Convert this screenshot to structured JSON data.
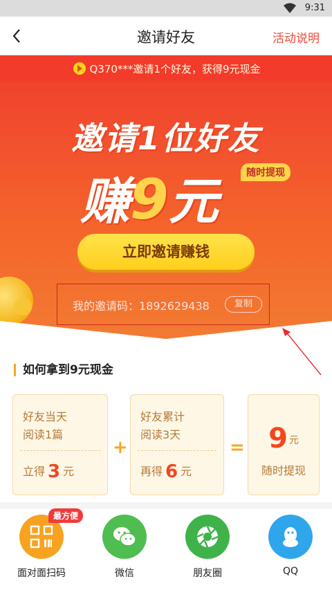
{
  "status_bar": {
    "time": "9:31"
  },
  "nav": {
    "title": "邀请好友",
    "rules_link": "活动说明"
  },
  "ticker": {
    "text": "Q370***邀请1个好友，获得9元现金"
  },
  "hero": {
    "headline": "邀请1位好友",
    "earn_prefix": "赚",
    "earn_amount": "9",
    "earn_unit": "元",
    "badge": "随时提现",
    "cta_label": "立即邀请赚钱",
    "invite_code_label": "我的邀请码：1892629438",
    "copy_label": "复制"
  },
  "howto": {
    "title": "如何拿到9元现金",
    "cards": [
      {
        "line1": "好友当天",
        "line2": "阅读1篇",
        "reward_prefix": "立得",
        "amount": "3",
        "unit": "元"
      },
      {
        "line1": "好友累计",
        "line2": "阅读3天",
        "reward_prefix": "再得",
        "amount": "6",
        "unit": "元"
      }
    ],
    "total": {
      "amount": "9",
      "unit": "元",
      "subtitle": "随时提现"
    },
    "plus": "+",
    "equals": "="
  },
  "share": {
    "best_tag": "最方便",
    "items": [
      {
        "label": "面对面扫码",
        "icon": "qr-code-icon",
        "color": "#f7a321"
      },
      {
        "label": "微信",
        "icon": "wechat-icon",
        "color": "#4fbd4f"
      },
      {
        "label": "朋友圈",
        "icon": "moments-icon",
        "color": "#3fb34a"
      },
      {
        "label": "QQ",
        "icon": "qq-icon",
        "color": "#2fa6ec"
      }
    ]
  },
  "colors": {
    "brand_red": "#f2493c",
    "accent_yellow": "#ffd44a",
    "highlight_orange": "#f5461e"
  }
}
